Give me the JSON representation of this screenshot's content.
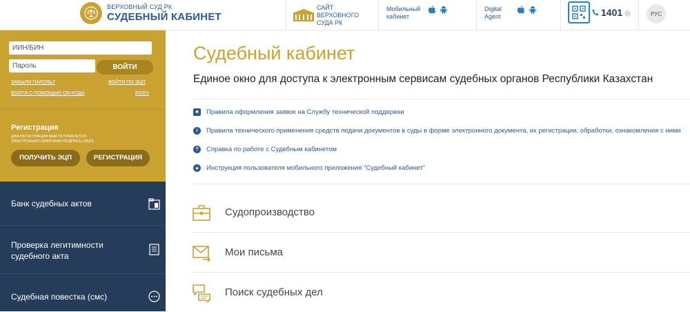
{
  "header": {
    "logo_sub": "ВЕРХОВНЫЙ СУД РК",
    "logo_main": "СУДЕБНЫЙ КАБИНЕТ",
    "site_link": "САЙТ ВЕРХОВНОГО СУДА РК",
    "mobile_label": "Мобильный кабинет",
    "agent_label": "Digital Agent",
    "phone": "1401",
    "lang": "РУС",
    "icons": [
      "emblem-icon",
      "building-icon",
      "apple-icon",
      "android-icon",
      "qr-icon",
      "phone-icon"
    ]
  },
  "login": {
    "iin_placeholder": "ИИН/БИН",
    "password_placeholder": "Пароль",
    "login_button": "ВОЙТИ",
    "forgot_password": "ЗАБЫЛИ ПАРОЛЬ?",
    "login_eds": "ВОЙТИ ПО ЭЦП",
    "login_qr": "ВОЙТИ С ПОМОЩЬЮ QR-КОДА",
    "egov": "EGOV"
  },
  "registration": {
    "title": "Регистрация",
    "note": "ДЛЯ РЕГИСТРАЦИИ ВАМ ПОТРЕБУЕТСЯ ЭЛЕКТРОННАЯ ЦИФРОВАЯ ПОДПИСЬ (ЭЦП).",
    "get_eds_button": "ПОЛУЧИТЬ ЭЦП",
    "register_button": "РЕГИСТРАЦИЯ"
  },
  "nav": {
    "items": [
      {
        "label": "Банк судебных актов",
        "icon": "archive-icon"
      },
      {
        "label": "Проверка легитимности судебного акта",
        "icon": "document-icon"
      },
      {
        "label": "Судебная повестка (смс)",
        "icon": "sms-icon"
      }
    ]
  },
  "main": {
    "title": "Судебный кабинет",
    "subtitle": "Единое окно для доступа к электронным сервисам судебных органов Республики Казахстан",
    "info_links": [
      {
        "text": "Правила оформления заявок на Службу технической поддержки",
        "icon": "square-icon"
      },
      {
        "text": "Правила технического применения средств подачи документов в суды в форме электронного документа, их регистрации, обработки, ознакомления с ними",
        "icon": "info-icon"
      },
      {
        "text": "Справка по работе с Судебным кабинетом",
        "icon": "question-icon"
      },
      {
        "text": "Инструкция пользователя мобильного приложения \"Судебный кабинет\"",
        "icon": "star-icon"
      }
    ],
    "services": [
      {
        "label": "Судопроизводство",
        "icon": "briefcase-icon"
      },
      {
        "label": "Мои письма",
        "icon": "envelope-icon"
      },
      {
        "label": "Поиск судебных дел",
        "icon": "chat-icon"
      }
    ]
  },
  "colors": {
    "gold": "#caa232",
    "gold_dark": "#a88522",
    "navy": "#253c5b",
    "link_blue": "#2c5a8c"
  }
}
